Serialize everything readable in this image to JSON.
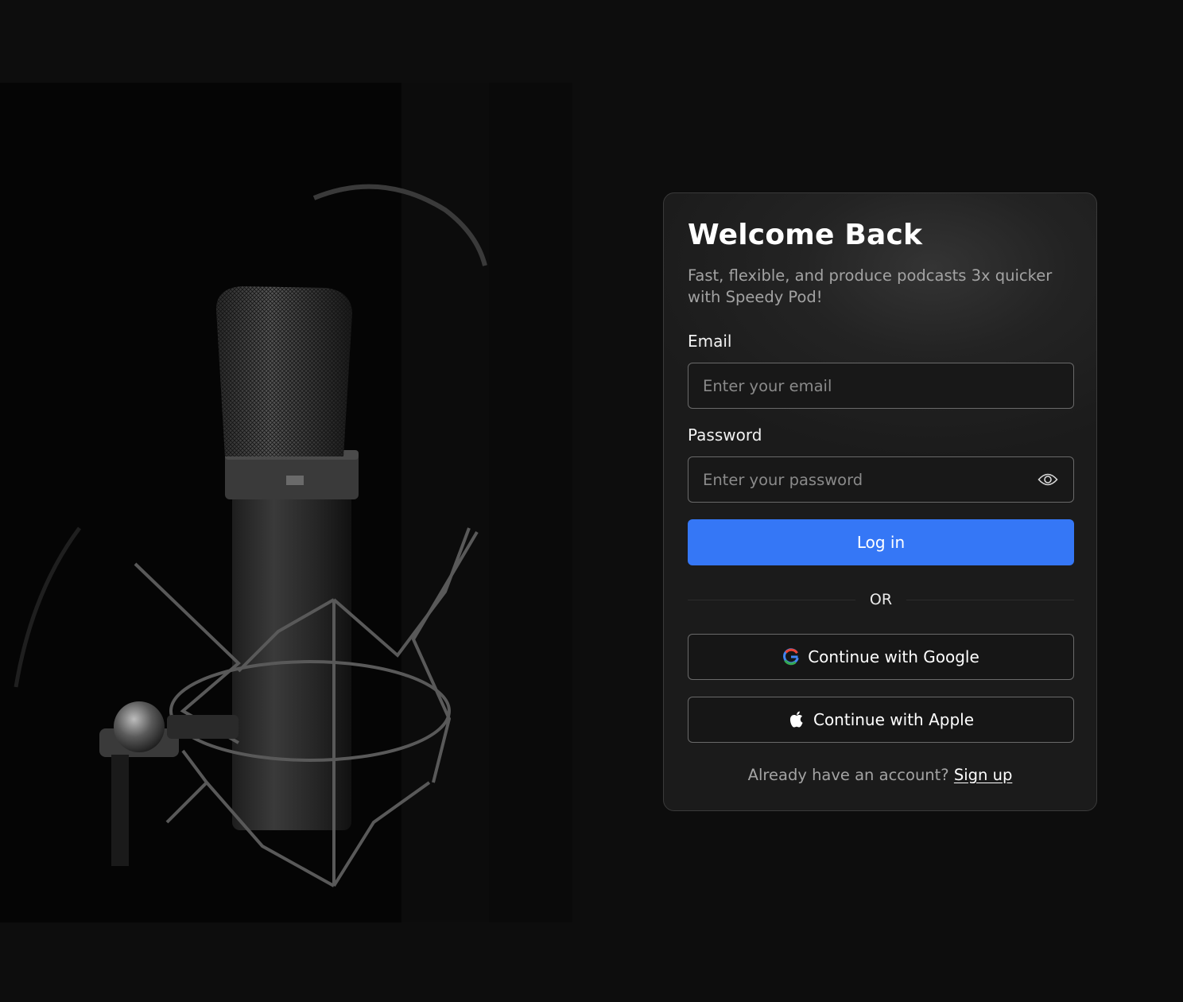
{
  "login": {
    "title": "Welcome Back",
    "subtitle": "Fast, flexible, and produce podcasts 3x quicker with Speedy Pod!",
    "email": {
      "label": "Email",
      "placeholder": "Enter your email",
      "value": ""
    },
    "password": {
      "label": "Password",
      "placeholder": "Enter your password",
      "value": ""
    },
    "login_button": "Log in",
    "divider": "OR",
    "google_button": "Continue with Google",
    "apple_button": "Continue with Apple",
    "footer_text": "Already have an account? ",
    "footer_link": "Sign up"
  },
  "icons": {
    "password_toggle": "eye-icon",
    "google": "google-icon",
    "apple": "apple-icon",
    "hero": "microphone"
  },
  "colors": {
    "accent": "#3577f6",
    "background": "#0d0d0d",
    "card": "#222222"
  }
}
